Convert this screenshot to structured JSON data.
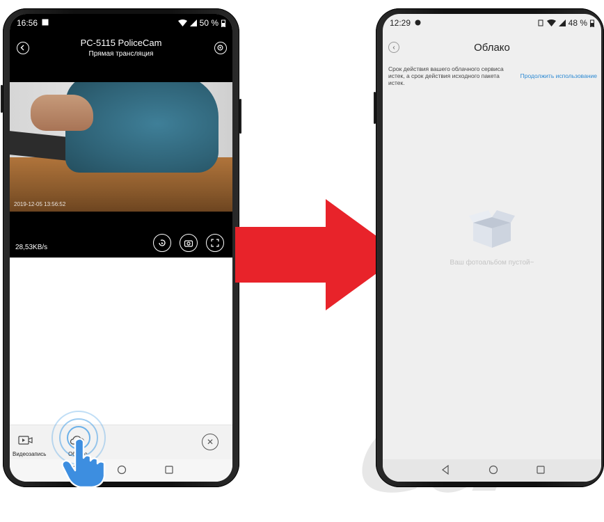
{
  "left_phone": {
    "status": {
      "time": "16:56",
      "battery": "50 %"
    },
    "header": {
      "title": "PC-5115 PoliceCam",
      "subtitle": "Прямая трансляция"
    },
    "video": {
      "timestamp": "2019-12-05 13:56:52"
    },
    "speed": "28,53KB/s",
    "bottom_bar": {
      "record_label": "Видеозапись",
      "cloud_label": "Облако"
    }
  },
  "right_phone": {
    "status": {
      "time": "12:29",
      "battery": "48 %"
    },
    "header": {
      "title": "Облако"
    },
    "notice": {
      "text": "Срок действия вашего облачного сервиса истек, а срок действия исходного пакета истек.",
      "link": "Продолжить использование"
    },
    "empty_message": "Ваш фотоальбом пустой~"
  },
  "colors": {
    "arrow": "#e8232a",
    "link": "#2d8ad3",
    "tap_ripple": "#4aa0e6",
    "hand": "#3d8ee0"
  },
  "icons": [
    "back-icon",
    "settings-icon",
    "playback-icon",
    "camera-icon",
    "fullscreen-icon",
    "video-record-icon",
    "cloud-icon",
    "close-icon",
    "tap-hand-icon",
    "empty-box-icon"
  ]
}
